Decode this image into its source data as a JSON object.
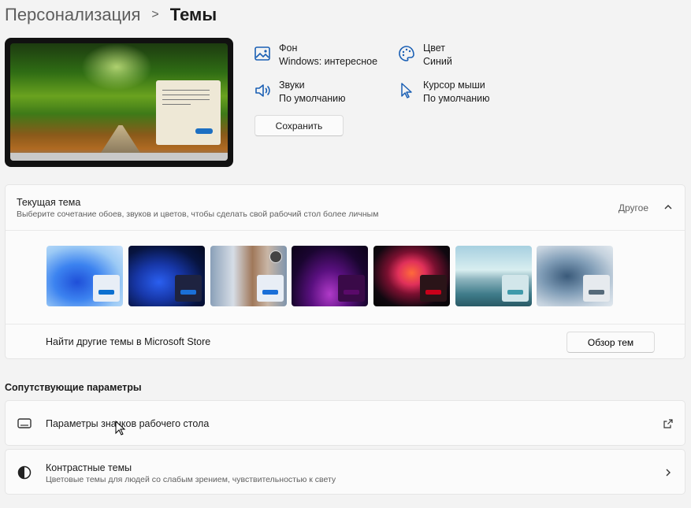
{
  "breadcrumb": {
    "parent": "Персонализация",
    "separator": ">",
    "current": "Темы"
  },
  "properties": [
    {
      "id": "background",
      "title": "Фон",
      "value": "Windows: интересное",
      "icon": "image-icon"
    },
    {
      "id": "color",
      "title": "Цвет",
      "value": "Синий",
      "icon": "palette-icon"
    },
    {
      "id": "sounds",
      "title": "Звуки",
      "value": "По умолчанию",
      "icon": "speaker-icon"
    },
    {
      "id": "cursor",
      "title": "Курсор мыши",
      "value": "По умолчанию",
      "icon": "pointer-icon"
    }
  ],
  "save_label": "Сохранить",
  "current_theme": {
    "title": "Текущая тема",
    "subtitle": "Выберите сочетание обоев, звуков и цветов, чтобы сделать свой рабочий стол более личным",
    "state": "Другое",
    "themes": [
      {
        "name": "windows-light",
        "accent": "#0a6fd0"
      },
      {
        "name": "windows-dark",
        "accent": "#1a6fd8"
      },
      {
        "name": "windows-spotlight",
        "accent": "#1a6fd8"
      },
      {
        "name": "glow",
        "accent": "#5a0a6a"
      },
      {
        "name": "captured-motion",
        "accent": "#c8001a"
      },
      {
        "name": "sunrise",
        "accent": "#3f9aaa"
      },
      {
        "name": "flow",
        "accent": "#556a7a"
      }
    ],
    "store_label": "Найти другие темы в Microsoft Store",
    "browse_label": "Обзор тем"
  },
  "related": {
    "title": "Сопутствующие параметры",
    "items": [
      {
        "title": "Параметры значков рабочего стола",
        "subtitle": "",
        "icon": "monitor-icon",
        "trail": "open-external-icon"
      },
      {
        "title": "Контрастные темы",
        "subtitle": "Цветовые темы для людей со слабым зрением, чувствительностью к свету",
        "icon": "contrast-icon",
        "trail": "chevron-right-icon"
      }
    ]
  },
  "colors": {
    "accent": "#0a6fd0",
    "background": "#f3f3f3",
    "card": "#fbfbfb"
  }
}
